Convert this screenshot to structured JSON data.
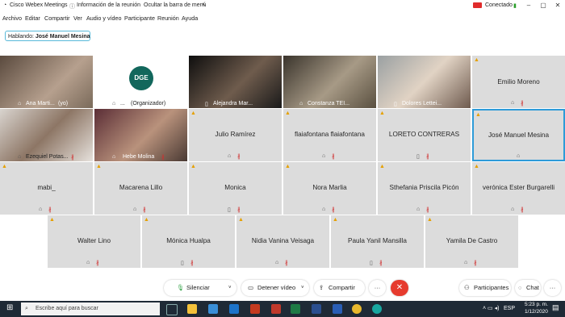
{
  "titlebar": {
    "app_title": "Cisco Webex Meetings",
    "meeting_info": "Información de la reunión",
    "hide_menu": "Ocultar la barra de menú",
    "status": "Conectado"
  },
  "menu": [
    "Archivo",
    "Editar",
    "Compartir",
    "Ver",
    "Audio y vídeo",
    "Participante",
    "Reunión",
    "Ayuda"
  ],
  "speaking": {
    "prefix": "Hablando:",
    "name": "José Manuel Mesina"
  },
  "tiles": {
    "r1": [
      {
        "name": "Ana Marti...",
        "suffix": "(yo)"
      },
      {
        "name": "...",
        "suffix": "(Organizador)",
        "logo": "DGE"
      },
      {
        "name": "Alejandra Mar..."
      },
      {
        "name": "Constanza TEI..."
      },
      {
        "name": "Dolores Lettei..."
      },
      {
        "name": "Emilio Moreno"
      }
    ],
    "r2": [
      {
        "name": "Ezequiel Potas..."
      },
      {
        "name": "Hebe Molina"
      },
      {
        "name": "Julio Ramírez"
      },
      {
        "name": "flaiafontana flaiafontana"
      },
      {
        "name": "LORETO CONTRERAS"
      },
      {
        "name": "José Manuel Mesina"
      }
    ],
    "r3": [
      {
        "name": "mabi_"
      },
      {
        "name": "Macarena Lillo"
      },
      {
        "name": "Monica"
      },
      {
        "name": "Nora Marlia"
      },
      {
        "name": "Sthefania Priscila Picón"
      },
      {
        "name": "verónica Ester Burgarelli"
      }
    ],
    "r4": [
      {
        "name": "Walter Lino"
      },
      {
        "name": "Mónica Hualpa"
      },
      {
        "name": "Nidia Vanina Veisaga"
      },
      {
        "name": "Paula Yanil Mansilla"
      },
      {
        "name": "Yamila De Castro"
      }
    ]
  },
  "controls": {
    "mute": "Silenciar",
    "video": "Detener vídeo",
    "share": "Compartir",
    "more": "···",
    "participants": "Participantes",
    "chat": "Chat",
    "overflow": "···"
  },
  "taskbar": {
    "search_placeholder": "Escribe aquí para buscar",
    "lang": "ESP",
    "time": "5:23 p. m.",
    "date": "1/12/2020"
  },
  "colors": {
    "highlight": "#2e9bd8",
    "end_call": "#e63b2e",
    "taskbar": "#1f2a36"
  }
}
